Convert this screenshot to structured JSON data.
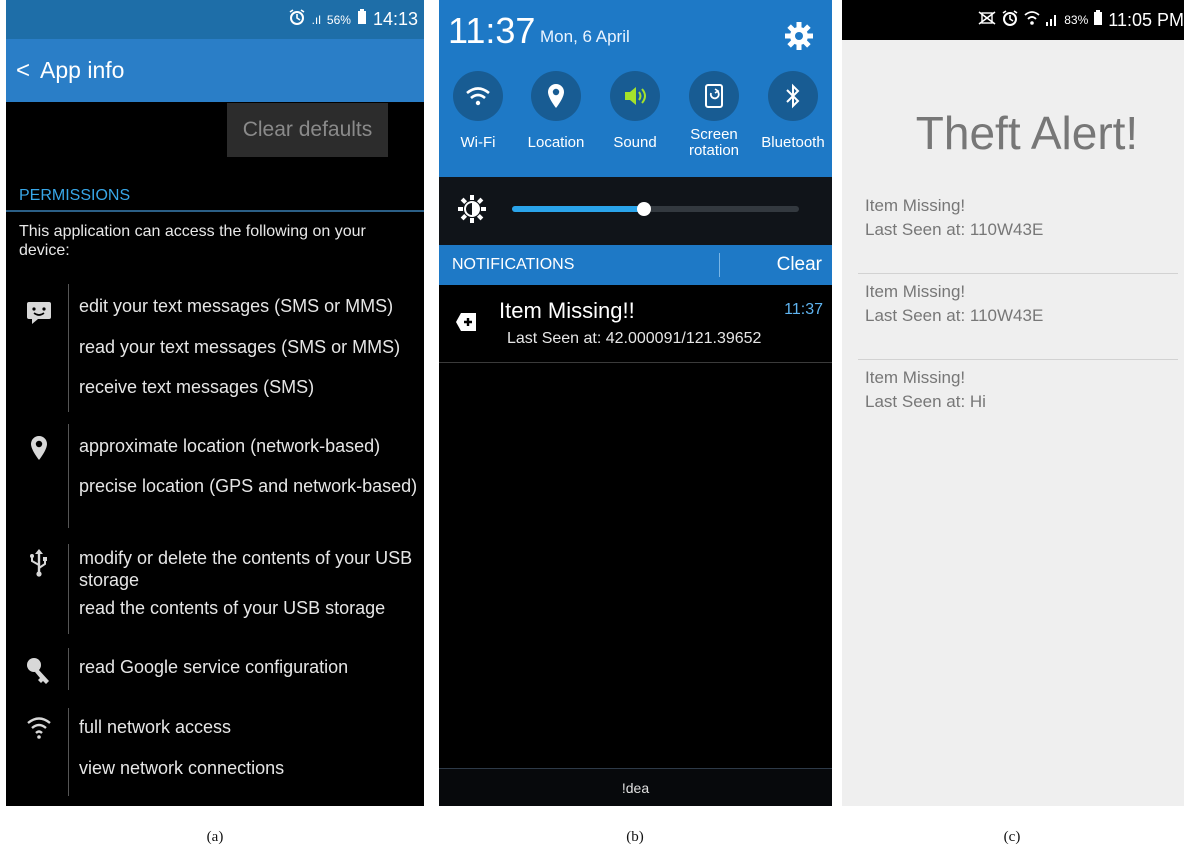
{
  "panel_a": {
    "status": {
      "signal": ".ıl",
      "battery": "56%",
      "time": "14:13"
    },
    "app_bar": {
      "back_label": "<",
      "title": "App info"
    },
    "clear_defaults_label": "Clear defaults",
    "permissions_title": "PERMISSIONS",
    "intro": "This application can access the following on your device:",
    "groups": [
      {
        "icon": "sms-icon",
        "items": [
          "edit your text messages (SMS or MMS)",
          "read your text messages (SMS or MMS)",
          "receive text messages (SMS)"
        ]
      },
      {
        "icon": "location-pin-icon",
        "items": [
          "approximate location (network-based)",
          "precise location (GPS and network-based)"
        ]
      },
      {
        "icon": "usb-icon",
        "items": [
          "modify or delete the contents of your USB storage",
          "read the contents of your USB storage"
        ]
      },
      {
        "icon": "key-icon",
        "items": [
          "read Google service configuration"
        ]
      },
      {
        "icon": "wifi-icon",
        "items": [
          "full network access",
          "view network connections"
        ]
      }
    ]
  },
  "panel_b": {
    "clock": "11:37",
    "date": "Mon, 6 April",
    "tiles": [
      {
        "label": "Wi-Fi",
        "icon": "wifi-icon"
      },
      {
        "label": "Location",
        "icon": "location-pin-icon"
      },
      {
        "label": "Sound",
        "icon": "sound-icon"
      },
      {
        "label": "Screen rotation",
        "icon": "screen-rotation-icon"
      },
      {
        "label": "Bluetooth",
        "icon": "bluetooth-icon"
      }
    ],
    "brightness": 0.46,
    "notifications_label": "NOTIFICATIONS",
    "clear_label": "Clear",
    "notification": {
      "title": "Item Missing!!",
      "time": "11:37",
      "text": "Last Seen at: 42.000091/121.39652"
    },
    "carrier": "!dea"
  },
  "panel_c": {
    "status": {
      "battery": "83%",
      "time": "11:05 PM"
    },
    "title": "Theft Alert!",
    "items": [
      {
        "line1": "Item Missing!",
        "line2": "Last Seen at: 110W43E"
      },
      {
        "line1": "Item Missing!",
        "line2": "Last Seen at: 110W43E"
      },
      {
        "line1": "Item Missing!",
        "line2": "Last Seen at: Hi"
      }
    ]
  },
  "captions": [
    "(a)",
    "(b)",
    "(c)"
  ],
  "colors": {
    "accent_blue": "#1e79c6",
    "link_blue": "#38a7e8",
    "sound_green": "#a4e22a"
  }
}
